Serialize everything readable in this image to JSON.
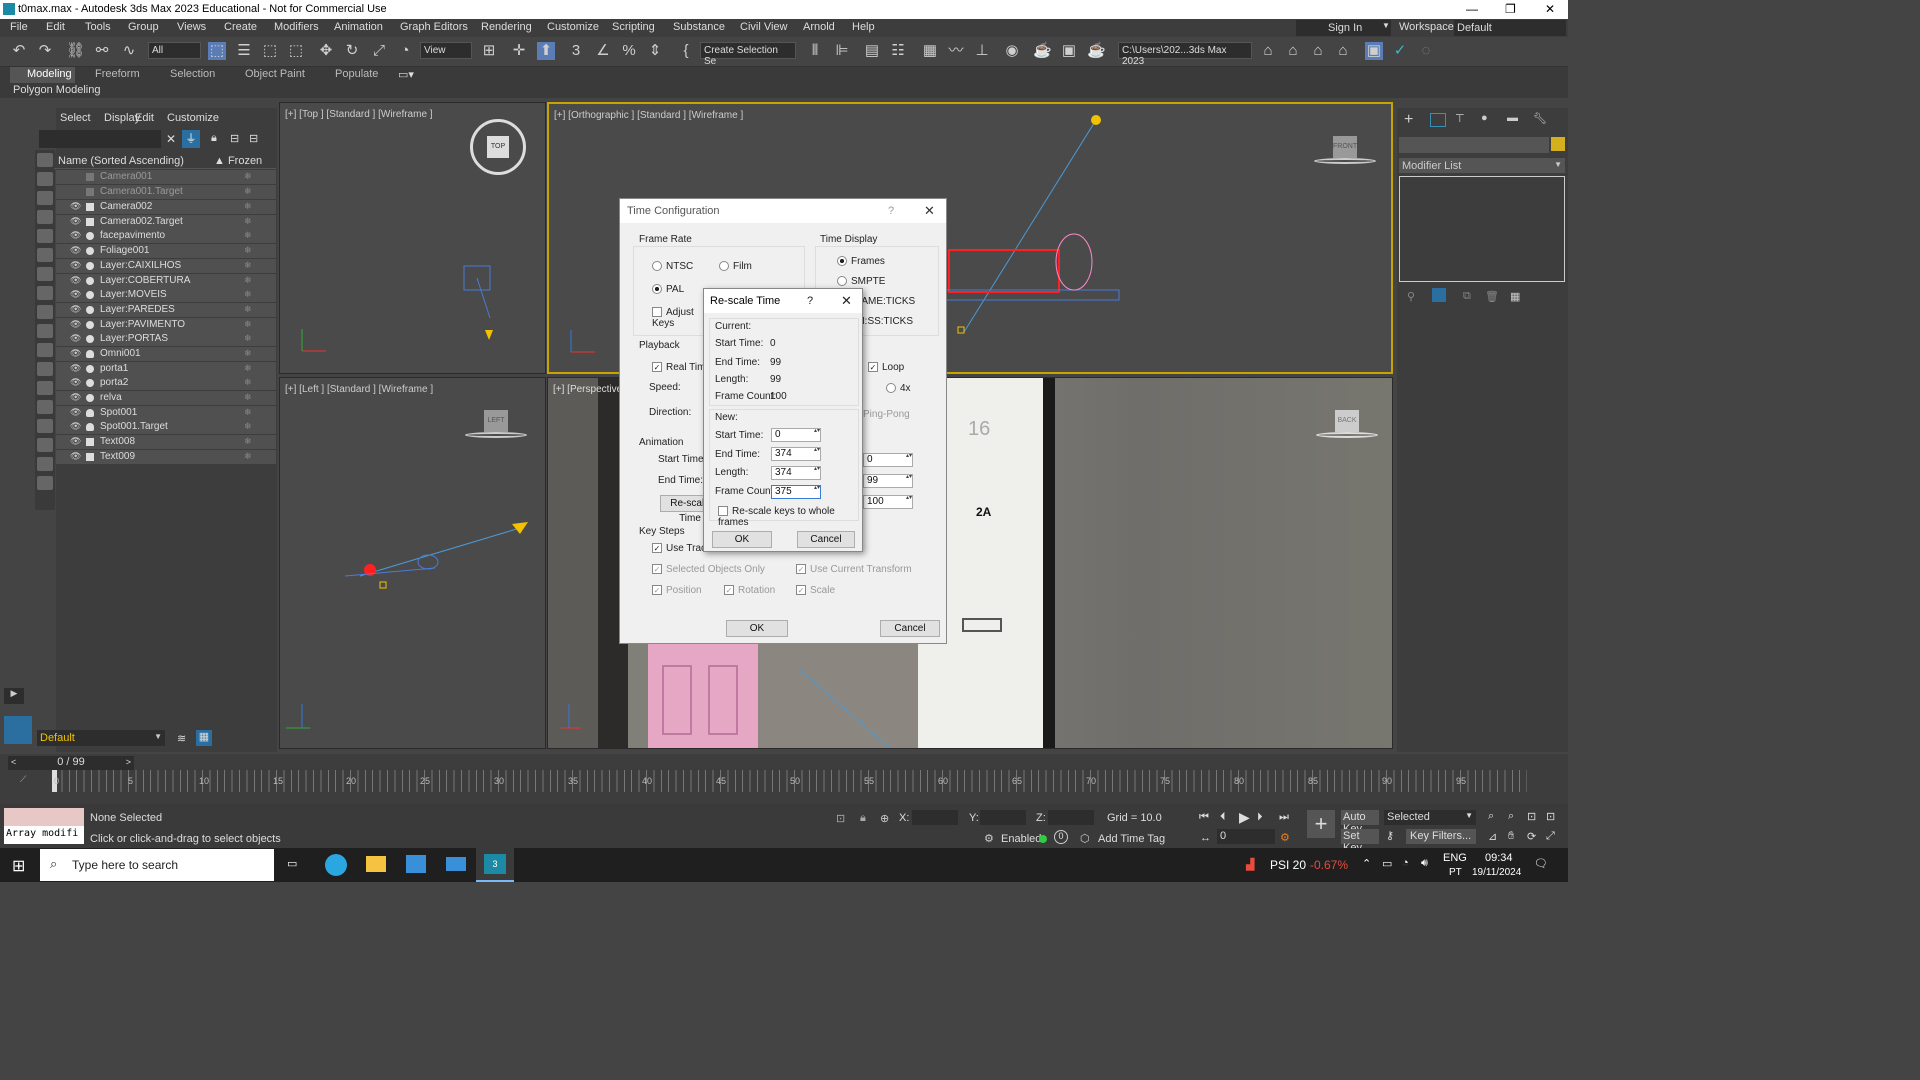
{
  "window": {
    "title": "t0max.max - Autodesk 3ds Max 2023 Educational - Not for Commercial Use"
  },
  "menu": [
    "File",
    "Edit",
    "Tools",
    "Group",
    "Views",
    "Create",
    "Modifiers",
    "Animation",
    "Graph Editors",
    "Rendering",
    "Customize",
    "Scripting",
    "Substance",
    "Civil View",
    "Arnold",
    "Help"
  ],
  "signin": "Sign In",
  "workspaces_label": "Workspaces:",
  "workspace": "Default",
  "toolbar": {
    "filter": "All",
    "view": "View",
    "selection_set": "Create Selection Se",
    "path": "C:\\Users\\202...3ds Max 2023"
  },
  "ribbon_tabs": [
    "Modeling",
    "Freeform",
    "Selection",
    "Object Paint",
    "Populate"
  ],
  "ribbon_sub": "Polygon Modeling",
  "explorer": {
    "tabs": [
      "Select",
      "Display",
      "Edit",
      "Customize"
    ],
    "col_name": "Name (Sorted Ascending)",
    "col_frozen": "▲ Frozen",
    "rows": [
      "Camera001",
      "Camera001.Target",
      "Camera002",
      "Camera002.Target",
      "facepavimento",
      "Foliage001",
      "Layer:CAIXILHOS",
      "Layer:COBERTURA",
      "Layer:MOVEIS",
      "Layer:PAREDES",
      "Layer:PAVIMENTO",
      "Layer:PORTAS",
      "Omni001",
      "porta1",
      "porta2",
      "relva",
      "Spot001",
      "Spot001.Target",
      "Text008",
      "Text009"
    ],
    "layer": "Default"
  },
  "viewports": {
    "top": "[+] [Top ] [Standard ] [Wireframe ]",
    "ortho": "[+] [Orthographic ] [Standard ] [Wireframe ]",
    "left": "[+] [Left ] [Standard ] [Wireframe ]",
    "persp": "[+] [Perspective",
    "door_number": "2A",
    "door_top": "16"
  },
  "time_config": {
    "title": "Time Configuration",
    "frame_rate": "Frame Rate",
    "ntsc": "NTSC",
    "film": "Film",
    "pal": "PAL",
    "adjust_keys": "Adjust Keys",
    "time_display": "Time Display",
    "frames": "Frames",
    "smpte": "SMPTE",
    "frame_ticks": "FRAME:TICKS",
    "mmss_ticks": "MM:SS:TICKS",
    "playback": "Playback",
    "real_time": "Real Time",
    "loop": "Loop",
    "speed": "Speed:",
    "x4": "4x",
    "direction": "Direction:",
    "pingpong": "Ping-Pong",
    "animation": "Animation",
    "start_time": "Start Time:",
    "end_time": "End Time:",
    "start_val": "0",
    "end_val": "99",
    "frame_count": "100",
    "rescale": "Re-scale Time",
    "key_steps": "Key Steps",
    "use_track_bar": "Use TrackBar",
    "sel_only": "Selected Objects Only",
    "use_cur": "Use Current Transform",
    "position": "Position",
    "rotation": "Rotation",
    "scale": "Scale",
    "ok": "OK",
    "cancel": "Cancel"
  },
  "rescale": {
    "title": "Re-scale Time",
    "current": "Current:",
    "new": "New:",
    "start_label": "Start Time:",
    "end_label": "End Time:",
    "length_label": "Length:",
    "count_label": "Frame Count:",
    "cur_start": "0",
    "cur_end": "99",
    "cur_len": "99",
    "cur_count": "100",
    "new_start": "0",
    "new_end": "374",
    "new_len": "374",
    "new_count": "375",
    "whole": "Re-scale keys to whole frames",
    "ok": "OK",
    "cancel": "Cancel"
  },
  "right_panel": {
    "modifier_list": "Modifier List"
  },
  "timeline": {
    "frame": "0 / 99",
    "ticks": [
      "0",
      "5",
      "10",
      "15",
      "20",
      "25",
      "30",
      "35",
      "40",
      "45",
      "50",
      "55",
      "60",
      "65",
      "70",
      "75",
      "80",
      "85",
      "90",
      "95"
    ]
  },
  "status": {
    "selection": "None Selected",
    "hint": "Click or click-and-drag to select objects",
    "script": "Array modifi",
    "x": "X:",
    "y": "Y:",
    "z": "Z:",
    "grid": "Grid = 10.0",
    "enabled": "Enabled:",
    "add_tag": "Add Time Tag",
    "autokey": "Auto Key",
    "setkey": "Set Key",
    "selected": "Selected",
    "keyfilters": "Key Filters...",
    "frame_field": "0"
  },
  "taskbar": {
    "search": "Type here to search",
    "stock": "PSI 20",
    "stock_change": "-0.67%",
    "lang": "ENG",
    "region": "PT",
    "time": "09:34",
    "date": "19/11/2024"
  },
  "colors": {
    "accent": "#f2c200",
    "wireframe_red": "#ff2020",
    "tree": "#ff88cc"
  }
}
